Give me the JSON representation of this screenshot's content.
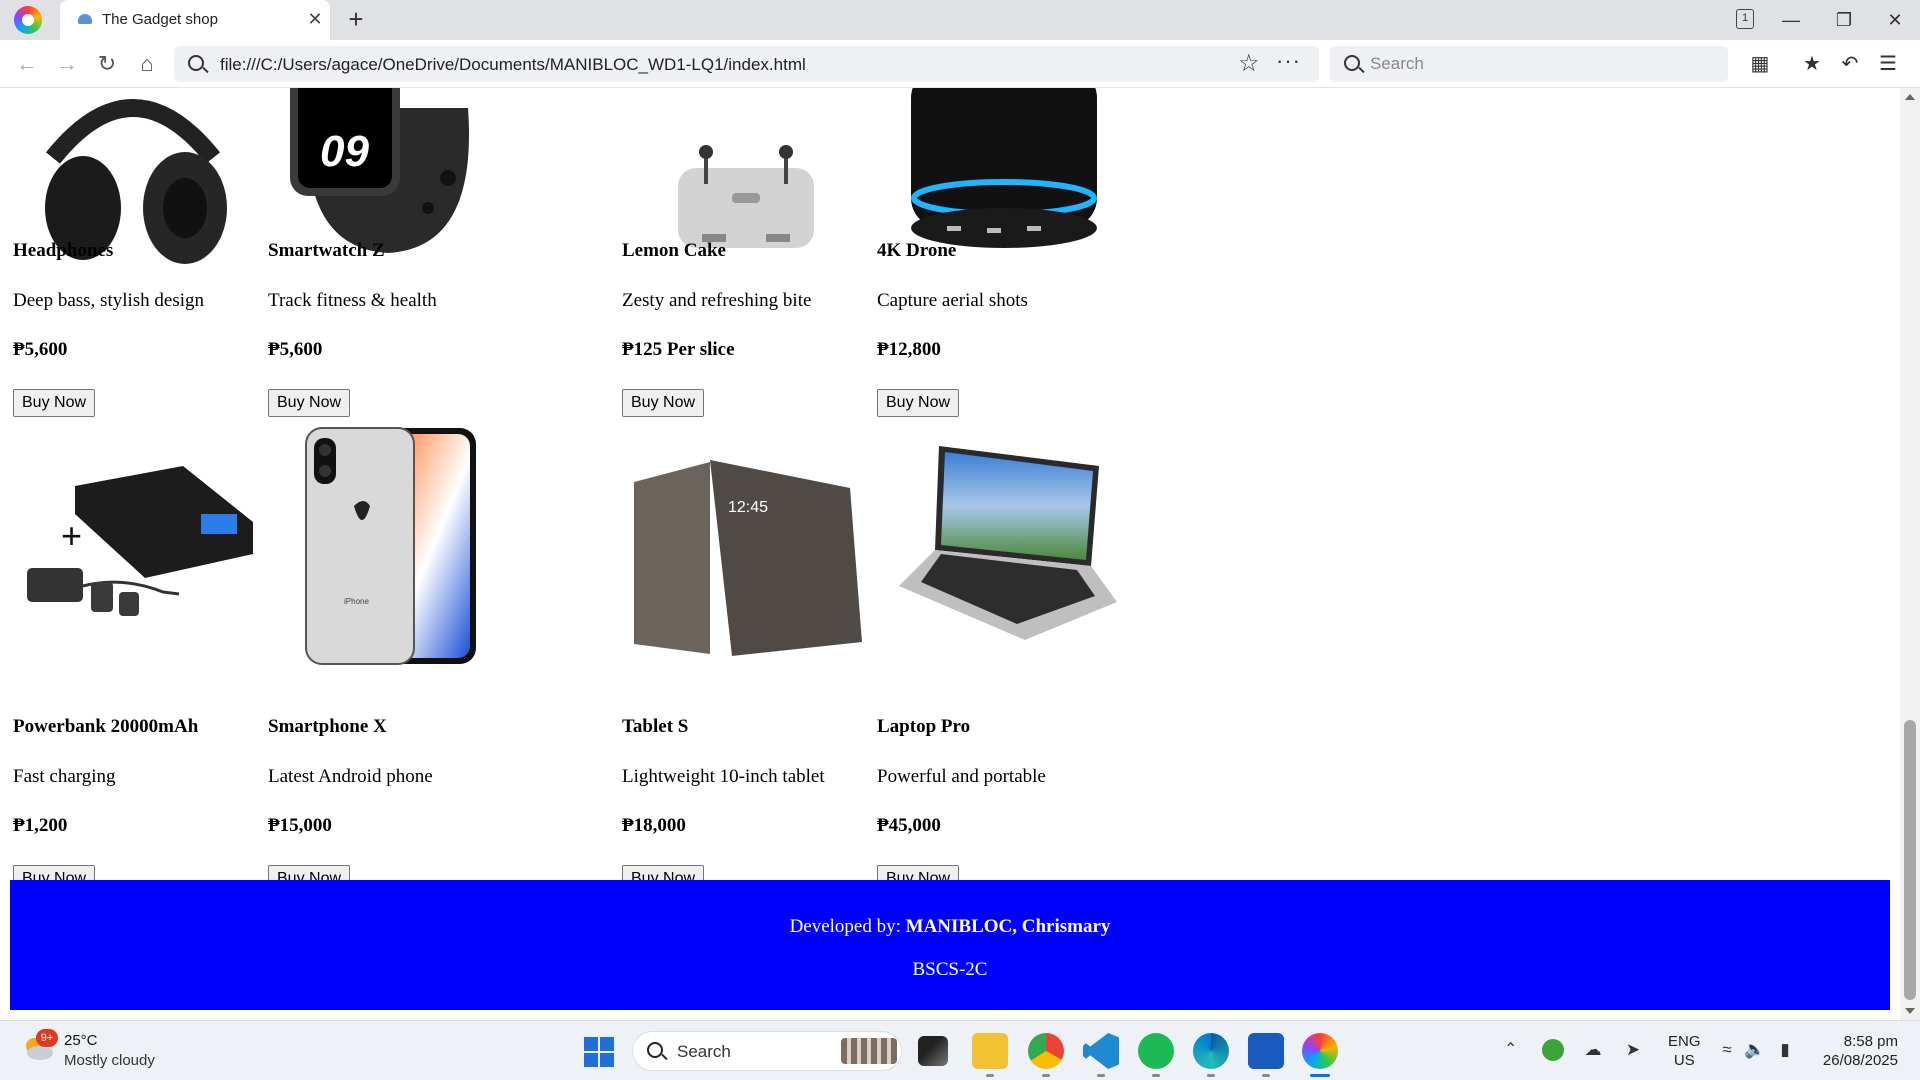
{
  "browser": {
    "tab_title": "The Gadget shop",
    "tab_close": "✕",
    "new_tab": "+",
    "tab_count": "1",
    "url": "file:///C:/Users/agace/OneDrive/Documents/MANIBLOC_WD1-LQ1/index.html",
    "search_placeholder": "Search"
  },
  "products_row1": [
    {
      "name": "Headphones",
      "description": "Deep bass, stylish design",
      "price": "₱5,600",
      "button": "Buy Now"
    },
    {
      "name": "Smartwatch Z",
      "description": "Track fitness & health",
      "price": "₱5,600",
      "button": "Buy Now",
      "watch_face_text": "09"
    },
    {
      "name": "Lemon Cake",
      "description": "Zesty and refreshing bite",
      "price": "₱125 Per slice",
      "button": "Buy Now"
    },
    {
      "name": "4K Drone",
      "description": "Capture aerial shots",
      "price": "₱12,800",
      "button": "Buy Now"
    }
  ],
  "products_row2": [
    {
      "name": "Powerbank 20000mAh",
      "description": "Fast charging",
      "price": "₱1,200",
      "button": "Buy Now"
    },
    {
      "name": "Smartphone X",
      "description": "Latest Android phone",
      "price": "₱15,000",
      "button": "Buy Now",
      "phone_label": "iPhone"
    },
    {
      "name": "Tablet S",
      "description": "Lightweight 10-inch tablet",
      "price": "₱18,000",
      "button": "Buy Now",
      "tablet_time": "12:45"
    },
    {
      "name": "Laptop Pro",
      "description": "Powerful and portable",
      "price": "₱45,000",
      "button": "Buy Now"
    }
  ],
  "footer": {
    "prefix": "Developed by: ",
    "developer": "MANIBLOC, Chrismary",
    "section": "BSCS-2C",
    "background": "#0000ff"
  },
  "taskbar": {
    "weather_badge": "9+",
    "weather_temp": "25°C",
    "weather_desc": "Mostly cloudy",
    "search_label": "Search",
    "lang_line1": "ENG",
    "lang_line2": "US",
    "time": "8:58 pm",
    "date": "26/08/2025"
  },
  "icons": [
    "browser-logo-icon",
    "back-arrow-icon",
    "forward-arrow-icon",
    "reload-icon",
    "home-icon",
    "star-icon",
    "more-icon",
    "search-icon",
    "grid-icon",
    "favorites-icon",
    "undo-icon",
    "menu-icon",
    "windows-start-icon",
    "file-explorer-icon",
    "chrome-icon",
    "vscode-icon",
    "spotify-icon",
    "edge-icon",
    "word-icon"
  ]
}
